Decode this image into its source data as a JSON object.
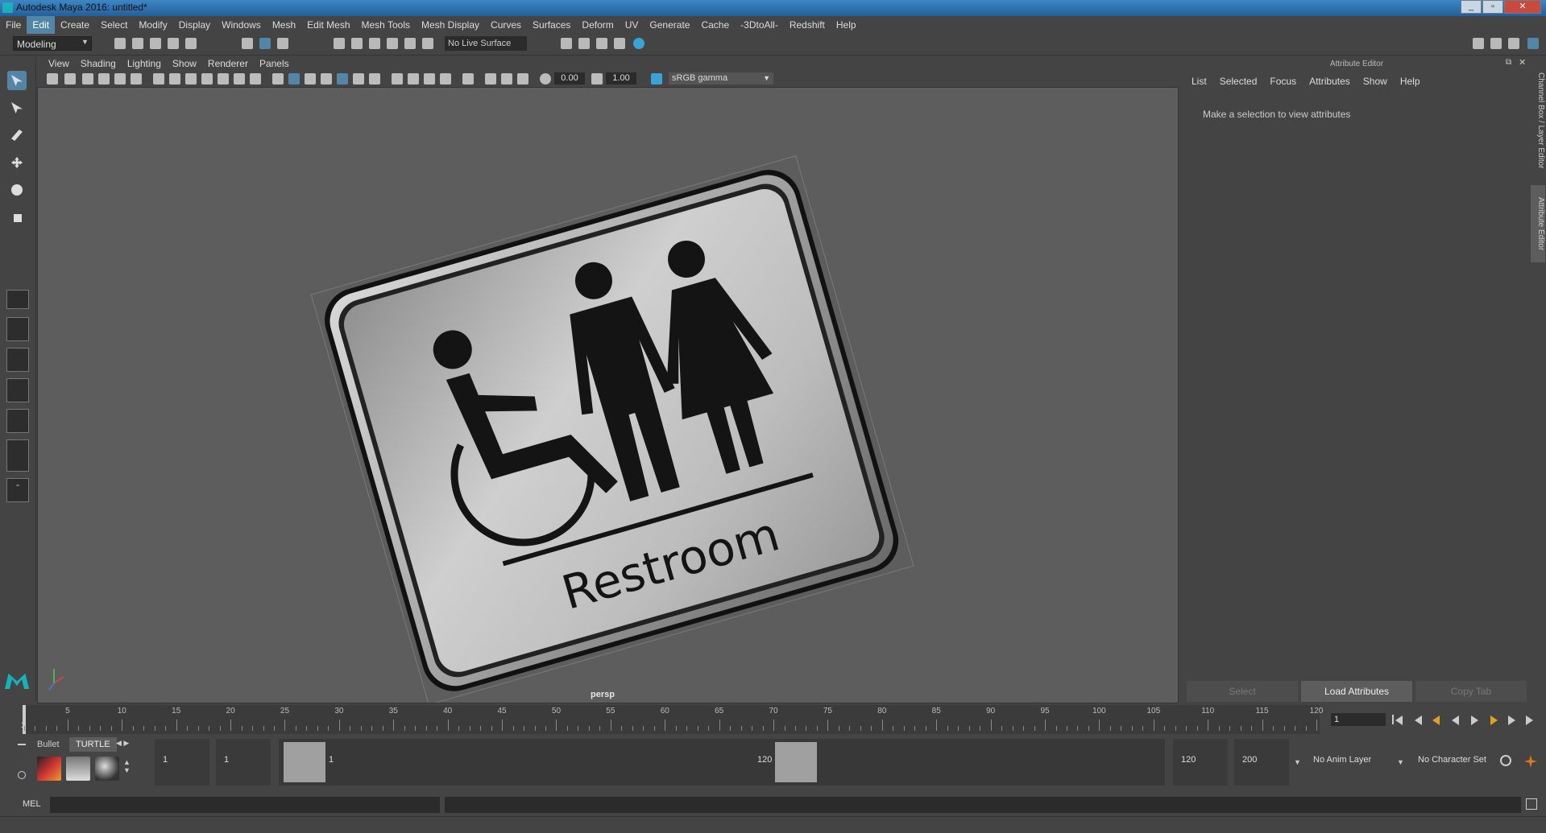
{
  "window": {
    "title": "Autodesk Maya 2016: untitled*"
  },
  "menubar": [
    "File",
    "Edit",
    "Create",
    "Select",
    "Modify",
    "Display",
    "Windows",
    "Mesh",
    "Edit Mesh",
    "Mesh Tools",
    "Mesh Display",
    "Curves",
    "Surfaces",
    "Deform",
    "UV",
    "Generate",
    "Cache",
    "-3DtoAll-",
    "Redshift",
    "Help"
  ],
  "menubar_active": "Edit",
  "statusline": {
    "mode": "Modeling",
    "live_surface": "No Live Surface"
  },
  "viewport": {
    "menu": [
      "View",
      "Shading",
      "Lighting",
      "Show",
      "Renderer",
      "Panels"
    ],
    "exposure": "0.00",
    "gamma_value": "1.00",
    "color_space": "sRGB gamma",
    "camera": "persp",
    "sign_text": "Restroom"
  },
  "attribute_editor": {
    "title": "Attribute Editor",
    "menu": [
      "List",
      "Selected",
      "Focus",
      "Attributes",
      "Show",
      "Help"
    ],
    "message": "Make a selection to view attributes",
    "buttons": [
      "Select",
      "Load Attributes",
      "Copy Tab"
    ]
  },
  "side_tabs": [
    "Channel Box / Layer Editor",
    "Attribute Editor"
  ],
  "timeslider": {
    "ticks": [
      "5",
      "10",
      "15",
      "20",
      "25",
      "30",
      "35",
      "40",
      "45",
      "50",
      "55",
      "60",
      "65",
      "70",
      "75",
      "80",
      "85",
      "90",
      "95",
      "100",
      "105",
      "110",
      "115",
      "120"
    ],
    "start_label": "1",
    "current_frame": "1"
  },
  "range": {
    "shelf_tabs": [
      "Bullet",
      "TURTLE"
    ],
    "start": "1",
    "playback_start": "1",
    "slider_start": "1",
    "slider_end": "120",
    "playback_end": "120",
    "end": "200",
    "anim_layer": "No Anim Layer",
    "character_set": "No Character Set"
  },
  "command_line": {
    "language": "MEL"
  },
  "colors": {
    "accent": "#5285a6",
    "viewport_bg": "#5d5d5d",
    "panel_bg": "#444444"
  }
}
